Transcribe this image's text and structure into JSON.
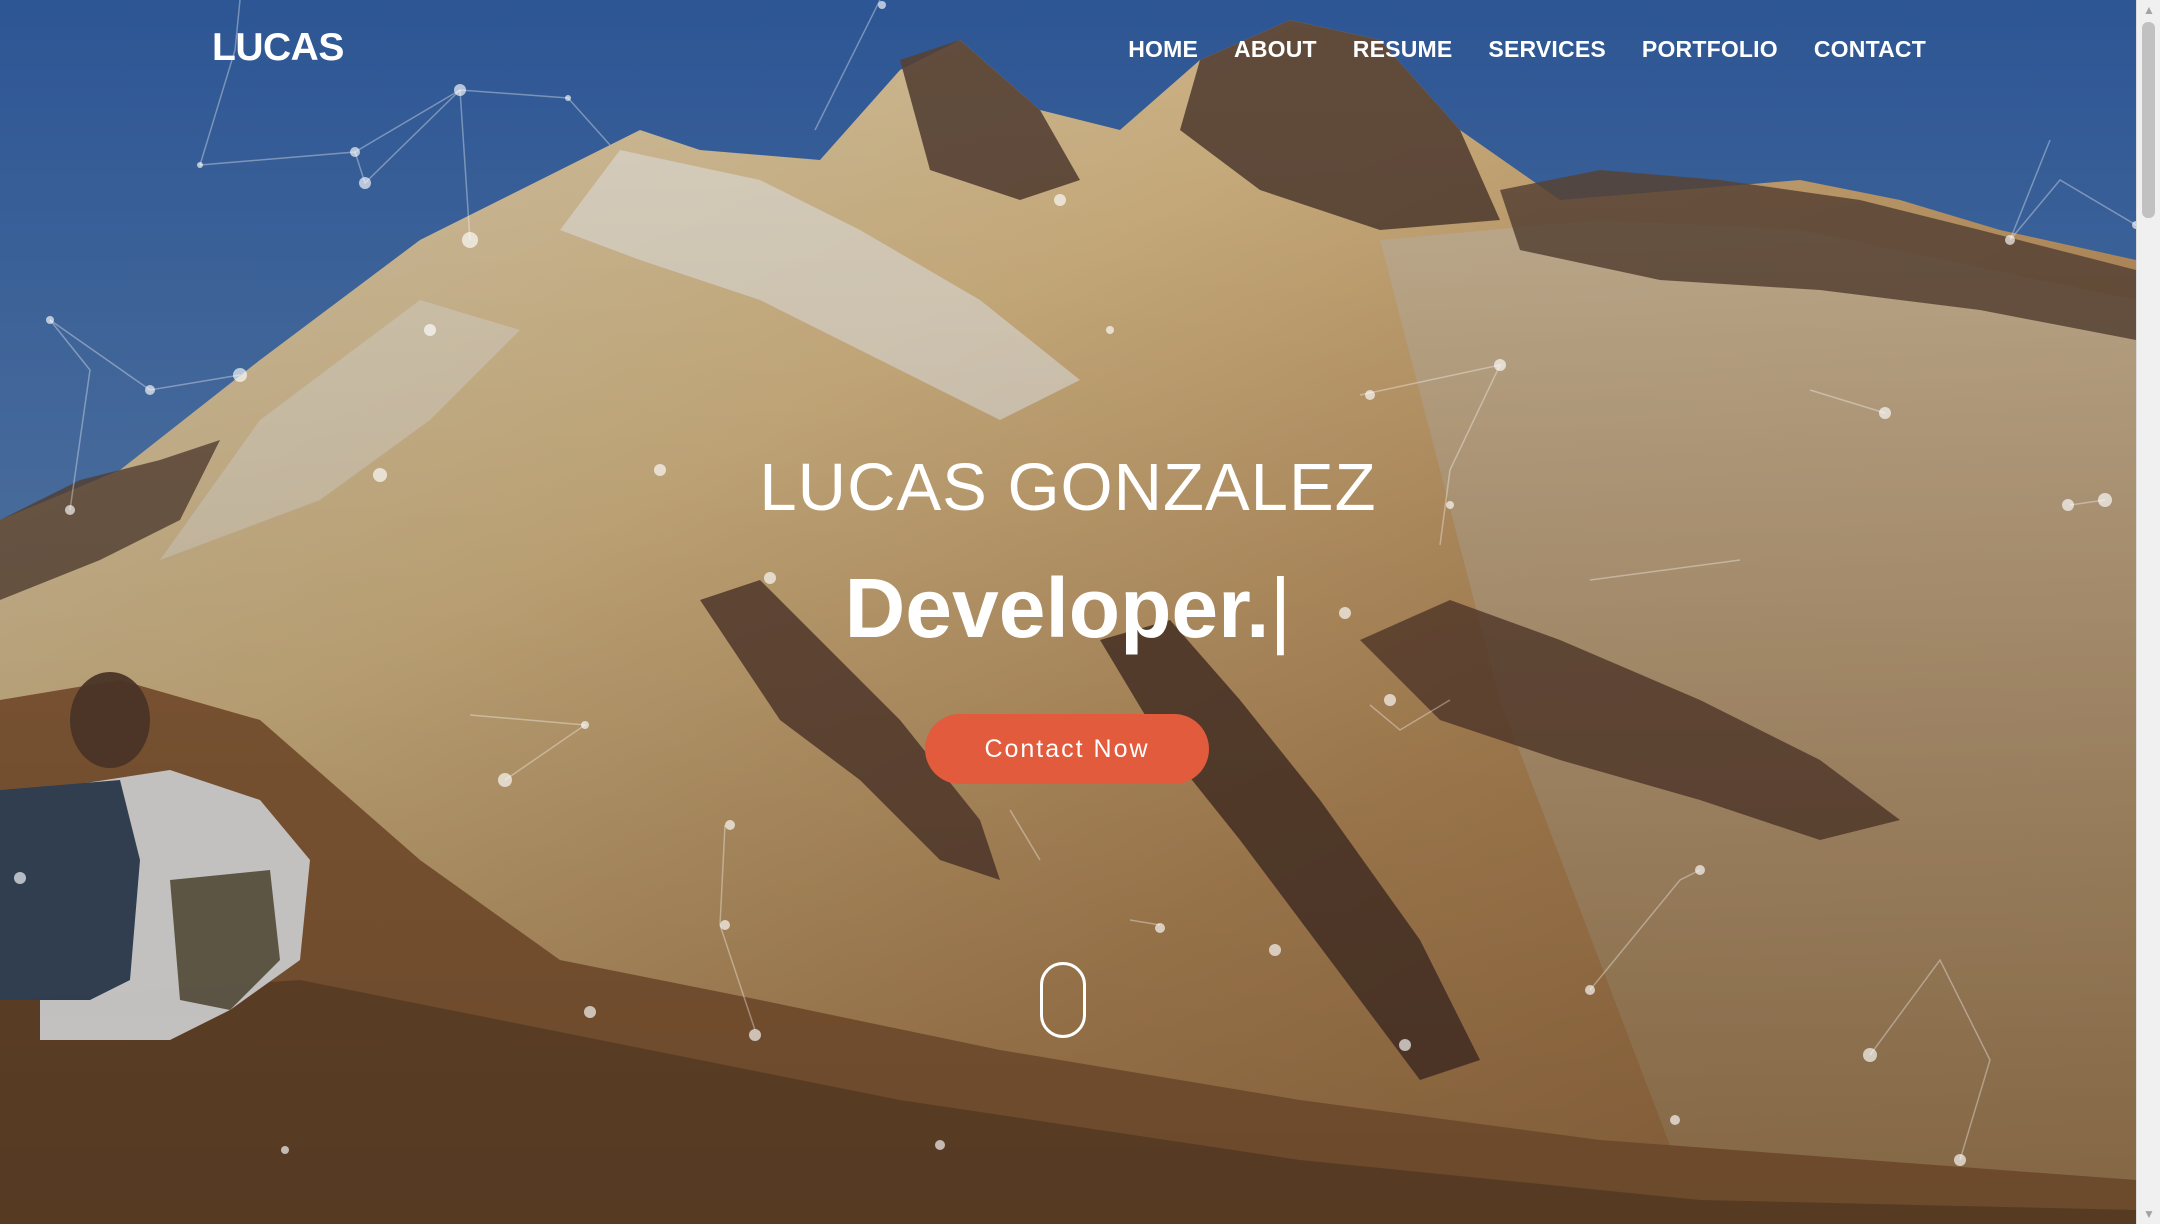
{
  "brand": "LUCAS",
  "nav": {
    "home": "HOME",
    "about": "ABOUT",
    "resume": "RESUME",
    "services": "SERVICES",
    "portfolio": "PORTFOLIO",
    "contact": "CONTACT"
  },
  "hero": {
    "name": "LUCAS GONZALEZ",
    "role": "Developer.",
    "caret": "|",
    "cta_label": "Contact Now",
    "background_scene": "mountain-ridge-hiker-photo",
    "overlay": "particle-network"
  },
  "colors": {
    "accent": "#e25b3c",
    "text": "#ffffff"
  },
  "icons": {
    "scroll_down": "mouse-scroll-icon"
  }
}
